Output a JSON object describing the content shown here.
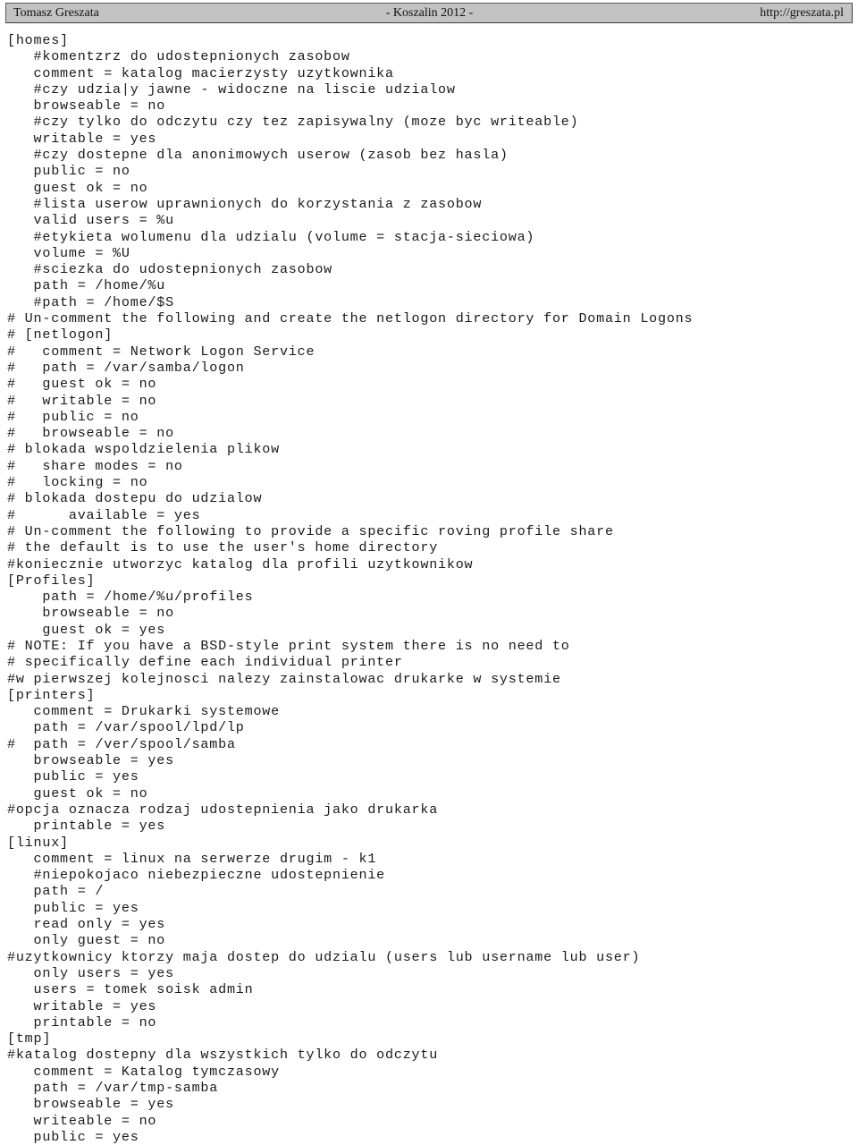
{
  "header": {
    "left": "Tomasz Greszata",
    "center": "- Koszalin 2012 -",
    "right": "http://greszata.pl"
  },
  "document": {
    "kind": "samba-smb-conf-listing",
    "lines": [
      "[homes]",
      "   #komentzrz do udostepnionych zasobow",
      "   comment = katalog macierzysty uzytkownika",
      "   #czy udzia|y jawne - widoczne na liscie udzialow",
      "   browseable = no",
      "   #czy tylko do odczytu czy tez zapisywalny (moze byc writeable)",
      "   writable = yes",
      "   #czy dostepne dla anonimowych userow (zasob bez hasla)",
      "   public = no",
      "   guest ok = no",
      "   #lista userow uprawnionych do korzystania z zasobow",
      "   valid users = %u",
      "   #etykieta wolumenu dla udzialu (volume = stacja-sieciowa)",
      "   volume = %U",
      "   #sciezka do udostepnionych zasobow",
      "   path = /home/%u",
      "   #path = /home/$S",
      "# Un-comment the following and create the netlogon directory for Domain Logons",
      "# [netlogon]",
      "#   comment = Network Logon Service",
      "#   path = /var/samba/logon",
      "#   guest ok = no",
      "#   writable = no",
      "#   public = no",
      "#   browseable = no",
      "# blokada wspoldzielenia plikow",
      "#   share modes = no",
      "#   locking = no",
      "# blokada dostepu do udzialow",
      "#      available = yes",
      "# Un-comment the following to provide a specific roving profile share",
      "# the default is to use the user's home directory",
      "#koniecznie utworzyc katalog dla profili uzytkownikow",
      "[Profiles]",
      "    path = /home/%u/profiles",
      "    browseable = no",
      "    guest ok = yes",
      "# NOTE: If you have a BSD-style print system there is no need to",
      "# specifically define each individual printer",
      "#w pierwszej kolejnosci nalezy zainstalowac drukarke w systemie",
      "[printers]",
      "   comment = Drukarki systemowe",
      "   path = /var/spool/lpd/lp",
      "#  path = /ver/spool/samba",
      "   browseable = yes",
      "   public = yes",
      "   guest ok = no",
      "#opcja oznacza rodzaj udostepnienia jako drukarka",
      "   printable = yes",
      "[linux]",
      "   comment = linux na serwerze drugim - k1",
      "   #niepokojaco niebezpieczne udostepnienie",
      "   path = /",
      "   public = yes",
      "   read only = yes",
      "   only guest = no",
      "#uzytkownicy ktorzy maja dostep do udzialu (users lub username lub user)",
      "   only users = yes",
      "   users = tomek soisk admin",
      "   writable = yes",
      "   printable = no",
      "[tmp]",
      "#katalog dostepny dla wszystkich tylko do odczytu",
      "   comment = Katalog tymczasowy",
      "   path = /var/tmp-samba",
      "   browseable = yes",
      "   writeable = no",
      "   public = yes"
    ]
  }
}
